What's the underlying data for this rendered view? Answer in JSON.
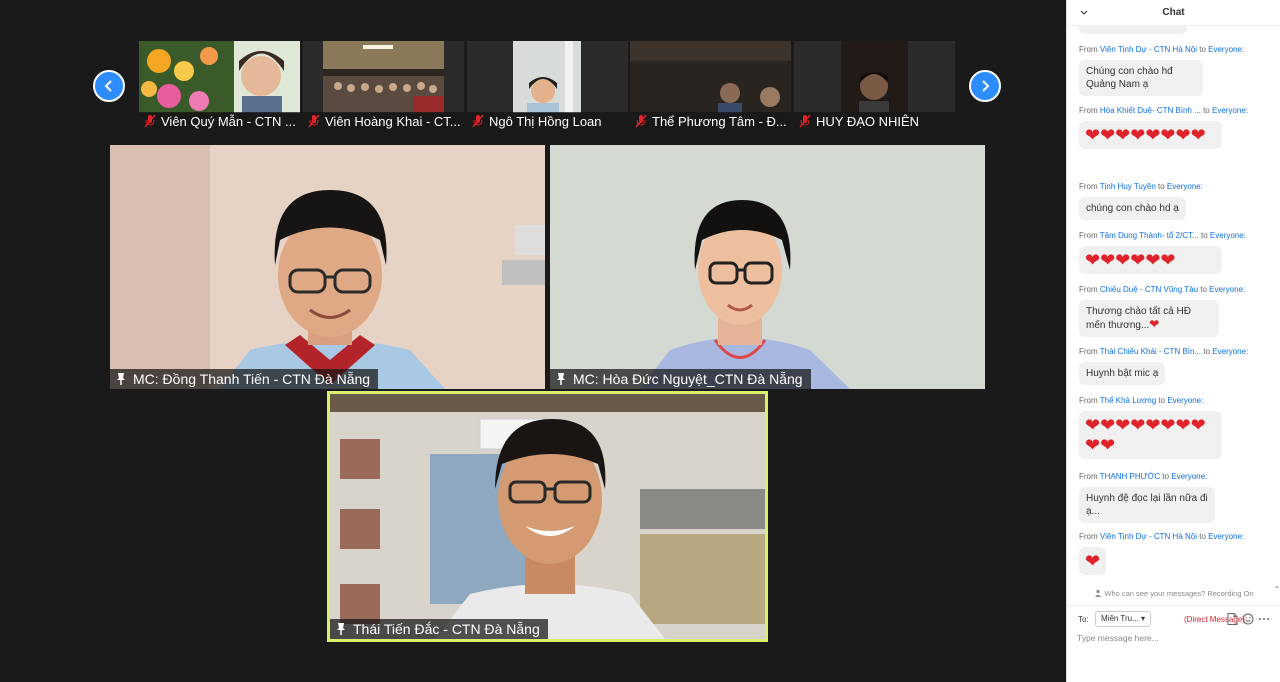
{
  "strip": {
    "prev_label": "previous",
    "next_label": "next",
    "participants": [
      {
        "name": "Viên Quý Mẫn - CTN ..."
      },
      {
        "name": "Viên Hoàng Khai - CT..."
      },
      {
        "name": "Ngô Thị Hồng Loan"
      },
      {
        "name": "Thể Phương Tâm - Đ..."
      },
      {
        "name": "HUY ĐẠO NHIÊN"
      }
    ]
  },
  "gallery": {
    "tiles": [
      {
        "name": "MC: Đồng Thanh Tiến - CTN Đà Nẵng"
      },
      {
        "name": "MC: Hòa Đức Nguyệt_CTN Đà Nẵng"
      },
      {
        "name": "Thái Tiến Đắc - CTN Đà Nẵng",
        "active_speaker": true
      }
    ]
  },
  "chat": {
    "title": "Chat",
    "from_word": "From",
    "to_word": "to",
    "messages": [
      {
        "sender": "Viên Tịnh Dự - CTN Hà Nội",
        "to": "Everyone:",
        "text": "Chúng con chào hđ Quảng Nam ạ"
      },
      {
        "sender": "Hòa Khiết Duệ- CTN Bình ...",
        "to": "Everyone:",
        "text": "❤❤❤❤❤❤❤❤"
      },
      {
        "sender": "Tịnh Huy Tuyền",
        "to": "Everyone:",
        "text": "chúng con chào hd ạ"
      },
      {
        "sender": "Tâm Dung Thành- tổ 2/CT...",
        "to": "Everyone:",
        "text": "❤❤❤❤❤❤"
      },
      {
        "sender": "Chiếu Duệ - CTN Vũng Tàu",
        "to": "Everyone:",
        "text": "Thương chào tất cả HĐ mến thương...",
        "emoji": "❤"
      },
      {
        "sender": "Thái Chiếu Khải - CTN Bìn...",
        "to": "Everyone:",
        "text": "Huynh bật mic ạ"
      },
      {
        "sender": "Thể Khả Lương",
        "to": "Everyone:",
        "text": "❤❤❤❤❤❤❤❤❤❤"
      },
      {
        "sender": "THANH PHƯỚC",
        "to": "Everyone:",
        "text": "Huynh đệ đọc lại lần nữa đi ạ..."
      },
      {
        "sender": "Viên Tịnh Dự - CTN Hà Nội",
        "to": "Everyone:",
        "text": "❤"
      }
    ],
    "privacy_note": "Who can see your messages? Recording On",
    "composer": {
      "to_label": "To:",
      "recipient": "Miên Tru...",
      "direct_label": "(Direct Message)",
      "placeholder": "Type message here..."
    }
  },
  "colors": {
    "accent": "#2d8cff",
    "active_speaker_border": "#d9f06a",
    "heart": "#e0232a",
    "link": "#0e71eb"
  }
}
